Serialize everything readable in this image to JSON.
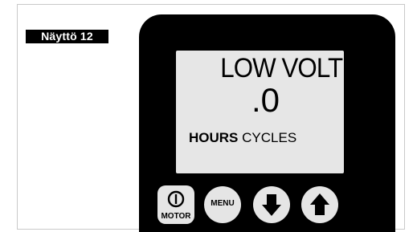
{
  "label": "Näyttö 12",
  "display": {
    "line1": "LOW VOLT",
    "line2": ".0",
    "hours_label": "HOURS",
    "cycles_label": "CYCLES"
  },
  "buttons": {
    "motor_label": "MOTOR",
    "menu_label": "MENU",
    "down_icon": "arrow-down-icon",
    "up_icon": "arrow-up-icon",
    "power_icon": "power-icon"
  },
  "colors": {
    "device_body": "#000000",
    "lcd_background": "#e6e6e6",
    "button_face": "#e5e5e5"
  }
}
